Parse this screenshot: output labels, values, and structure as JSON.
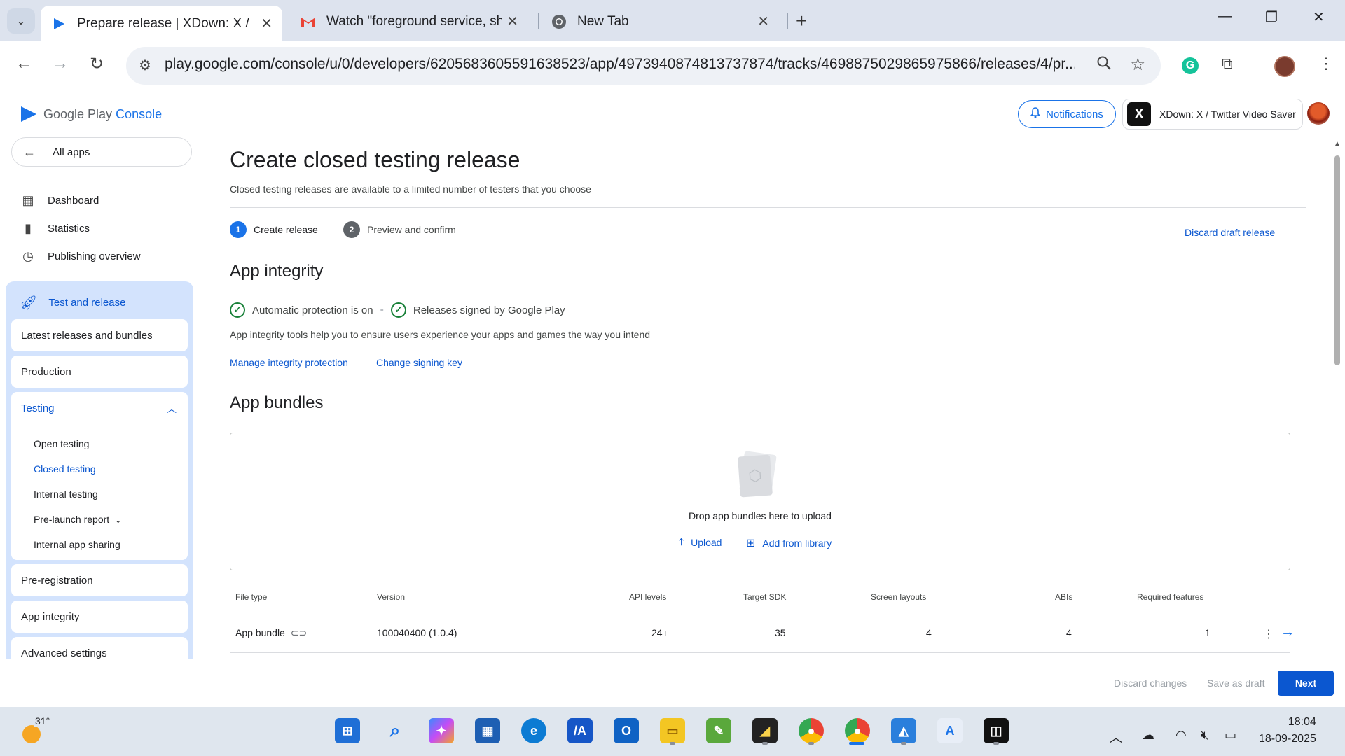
{
  "browser": {
    "tabs": [
      {
        "title": "Prepare release | XDown: X / Tw",
        "active": true
      },
      {
        "title": "Watch \"foreground service, sho",
        "active": false
      },
      {
        "title": "New Tab",
        "active": false
      }
    ],
    "url": "play.google.com/console/u/0/developers/6205683605591638523/app/4973940874813737874/tracks/4698875029865975866/releases/4/pr..."
  },
  "header": {
    "brand_google_play": "Google Play",
    "brand_console": "Console",
    "notifications_label": "Notifications",
    "app_name": "XDown: X / Twitter Video Saver",
    "app_logo_letter": "X"
  },
  "sidebar": {
    "all_apps": "All apps",
    "links": [
      {
        "label": "Dashboard",
        "icon": "dashboard-icon"
      },
      {
        "label": "Statistics",
        "icon": "bar-chart-icon"
      },
      {
        "label": "Publishing overview",
        "icon": "history-icon"
      }
    ],
    "test_and_release": "Test and release",
    "cards": {
      "latest": "Latest releases and bundles",
      "production": "Production",
      "testing": "Testing",
      "preregistration": "Pre-registration",
      "integrity": "App integrity",
      "advanced": "Advanced settings"
    },
    "testing_items": [
      "Open testing",
      "Closed testing",
      "Internal testing",
      "Pre-launch report",
      "Internal app sharing"
    ],
    "active_testing_item": "Closed testing"
  },
  "main": {
    "title": "Create closed testing release",
    "subtitle": "Closed testing releases are available to a limited number of testers that you choose",
    "steps": [
      {
        "num": "1",
        "label": "Create release",
        "active": true
      },
      {
        "num": "2",
        "label": "Preview and confirm",
        "active": false
      }
    ],
    "discard_draft": "Discard draft release",
    "integrity": {
      "heading": "App integrity",
      "check1": "Automatic protection is on",
      "check2": "Releases signed by Google Play",
      "description": "App integrity tools help you to ensure users experience your apps and games the way you intend",
      "link_manage": "Manage integrity protection",
      "link_signing": "Change signing key"
    },
    "bundles": {
      "heading": "App bundles",
      "drop_text": "Drop app bundles here to upload",
      "upload": "Upload",
      "add_library": "Add from library",
      "columns": [
        "File type",
        "Version",
        "API levels",
        "Target SDK",
        "Screen layouts",
        "ABIs",
        "Required features"
      ],
      "rows": [
        {
          "file_type": "App bundle",
          "version": "100040400 (1.0.4)",
          "api_levels": "24+",
          "target_sdk": "35",
          "screen_layouts": "4",
          "abis": "4",
          "required_features": "1"
        }
      ]
    }
  },
  "footer": {
    "discard_changes": "Discard changes",
    "save_draft": "Save as draft",
    "next": "Next"
  },
  "taskbar": {
    "temperature": "31°",
    "time": "18:04",
    "date": "18-09-2025"
  },
  "colors": {
    "accent": "#0b57d0",
    "nav_highlight": "#d3e3fd",
    "success": "#188038"
  }
}
